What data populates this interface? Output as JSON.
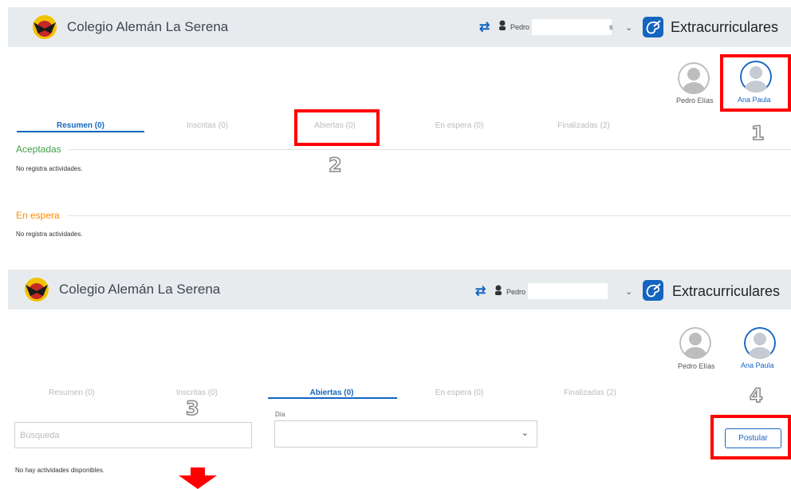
{
  "colors": {
    "accent": "#1565c0",
    "highlight": "#ff0000",
    "accepted": "#43a047",
    "waiting": "#fb8c00"
  },
  "panel1": {
    "header": {
      "school": "Colegio Alemán La Serena",
      "user_label": "Pedro",
      "user_suffix": "s",
      "app_title": "Extracurriculares"
    },
    "students": [
      {
        "name": "Pedro Elías",
        "active": false
      },
      {
        "name": "Ana Paula",
        "active": true
      }
    ],
    "tabs": [
      "Resumen (0)",
      "Inscritas (0)",
      "Abiertas (0)",
      "En espera (0)",
      "Finalizadas (2)"
    ],
    "active_tab": 0,
    "sections": [
      {
        "title": "Aceptadas",
        "empty": "No registra actividades."
      },
      {
        "title": "En espera",
        "empty": "No registra actividades."
      }
    ],
    "steps": [
      "1",
      "2"
    ]
  },
  "panel2": {
    "header": {
      "school": "Colegio Alemán La Serena",
      "user_label": "Pedro",
      "user_suffix": "",
      "app_title": "Extracurriculares"
    },
    "students": [
      {
        "name": "Pedro Elías",
        "active": false
      },
      {
        "name": "Ana Paula",
        "active": true
      }
    ],
    "tabs": [
      "Resumen (0)",
      "Inscritas (0)",
      "Abiertas (0)",
      "En espera (0)",
      "Finalizadas (2)"
    ],
    "active_tab": 2,
    "search_placeholder": "Búsqueda",
    "day_label": "Día",
    "day_value": "",
    "postular_label": "Postular",
    "empty": "No hay actividades disponibles.",
    "steps": [
      "3",
      "4"
    ]
  },
  "icons": {
    "swap": "swap-arrows-icon",
    "user": "user-icon",
    "chevron": "chevron-down-icon",
    "app": "palette-icon",
    "arrow": "arrow-down-icon"
  }
}
